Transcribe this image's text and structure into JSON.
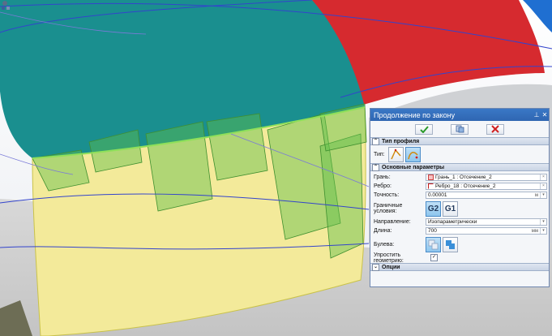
{
  "panel": {
    "title": "Продолжение по закону",
    "pin_glyph": "📌",
    "close_glyph": "✕",
    "actions": [
      {
        "name": "ok-button",
        "icon": "check-icon"
      },
      {
        "name": "preview-button",
        "icon": "preview-icon"
      },
      {
        "name": "cancel-button",
        "icon": "cross-icon"
      }
    ],
    "profile_section": {
      "title": "Тип профиля",
      "type_label": "Тип:"
    },
    "main_section": {
      "title": "Основные параметры",
      "face_label": "Грань:",
      "face_value": "Грань_1 : Отсечение_2",
      "edge_label": "Ребро:",
      "edge_value": "Ребро_18 : Отсечение_2",
      "precision_label": "Точность:",
      "precision_value": "0.00001",
      "precision_unit": "м",
      "boundary_label": "Граничные условия:",
      "boundary_g2": "G2",
      "boundary_g1": "G1",
      "direction_label": "Направление:",
      "direction_value": "Изопараметрически",
      "length_label": "Длина:",
      "length_value": "700",
      "length_unit": "мм",
      "boolean_label": "Булева:",
      "simplify_label": "Упростить геометрию:",
      "simplify_checked": true
    },
    "options_section": {
      "title": "Опции"
    }
  },
  "colors": {
    "teal_surface": "#1a8f8f",
    "red_surface": "#d62a2f",
    "yellow_surface": "#f3ea9a",
    "green_patches": "#5fbf4a",
    "blue_edge": "#2f6fd0",
    "panel_title": "#3572c0"
  }
}
